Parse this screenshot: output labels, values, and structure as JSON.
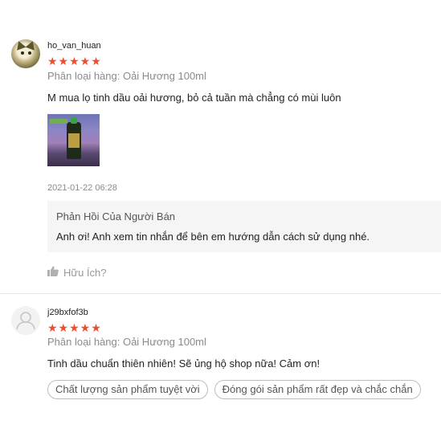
{
  "reviews": [
    {
      "username": "ho_van_huan",
      "rating_stars": "★★★★★",
      "rating": 5,
      "variant": "Phân loại hàng: Oải Hương 100ml",
      "comment": "M mua lọ tinh dầu oải hương,  bỏ cả tuần mà chẳng có mùi luôn",
      "date": "2021-01-22 06:28",
      "seller_reply": {
        "title": "Phản Hồi Của Người Bán",
        "text": "Anh ơi! Anh xem tin nhắn để bên em hướng dẫn cách sử dụng nhé."
      },
      "helpful_label": "Hữu Ích?"
    },
    {
      "username": "j29bxfof3b",
      "rating_stars": "★★★★★",
      "rating": 5,
      "variant": "Phân loại hàng: Oải Hương 100ml",
      "comment": "Tinh dầu chuẩn thiên nhiên! Sẽ ủng hộ shop nữa! Cảm ơn!",
      "tags": [
        "Chất lượng sản phẩm tuyệt vời",
        "Đóng gói sản phẩm rất đẹp và chắc chắn"
      ]
    }
  ],
  "colors": {
    "star": "#ee4d2d",
    "muted_text": "#8a8a8a",
    "reply_bg": "#f5f5f5"
  }
}
